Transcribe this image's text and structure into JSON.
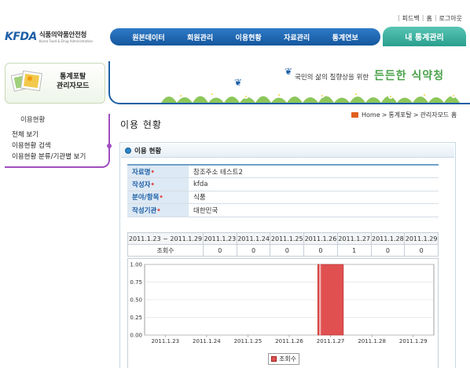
{
  "util_links": [
    "피드백",
    "홈",
    "로그아웃"
  ],
  "logo": {
    "mark": "KFDA",
    "name": "식품의약품안전청",
    "sub": "Korea Food & Drug Administration"
  },
  "nav": {
    "items": [
      "원본데이터",
      "회원관리",
      "이용현황",
      "자료관리",
      "통계연보"
    ],
    "active": "내 통계관리"
  },
  "banner": {
    "slogan": "국민의 삶의 질향상을 위한",
    "brand": "든든한 식약청"
  },
  "sidebar": {
    "title_line1": "통계포탈",
    "title_line2": "관리자모드",
    "current": "이용현황",
    "links": [
      "전체 보기",
      "이용현황 검색",
      "이용현황 분류/기관별 보기"
    ]
  },
  "page": {
    "title": "이용 현황"
  },
  "breadcrumb": {
    "home": "Home",
    "path1": "통계포탈",
    "path2": "관리자모드 홈",
    "sep": ">"
  },
  "section": {
    "title": "이용 현황"
  },
  "info": [
    {
      "label": "자료명",
      "value": "참조주소 테스트2"
    },
    {
      "label": "작성자",
      "value": "kfda"
    },
    {
      "label": "분야/항목",
      "value": "식품"
    },
    {
      "label": "작성기관",
      "value": "대한민국"
    }
  ],
  "stats": {
    "range": "2011.1.23 ~ 2011.1.29",
    "row_label": "조회수",
    "dates": [
      "2011.1.23",
      "2011.1.24",
      "2011.1.25",
      "2011.1.26",
      "2011.1.27",
      "2011.1.28",
      "2011.1.29"
    ],
    "counts": [
      "0",
      "0",
      "0",
      "0",
      "1",
      "0",
      "0"
    ]
  },
  "chart_data": {
    "type": "bar",
    "categories": [
      "2011.1.23",
      "2011.1.24",
      "2011.1.25",
      "2011.1.26",
      "2011.1.27",
      "2011.1.28",
      "2011.1.29"
    ],
    "series": [
      {
        "name": "조회수",
        "values": [
          0,
          0,
          0,
          0,
          1,
          0,
          0
        ]
      }
    ],
    "yticks": [
      "1.00",
      "0.75",
      "0.50",
      "0.25",
      "0.00"
    ],
    "ylim": [
      0,
      1
    ],
    "grid": true,
    "legend": "bottom",
    "color": "#e05050"
  }
}
